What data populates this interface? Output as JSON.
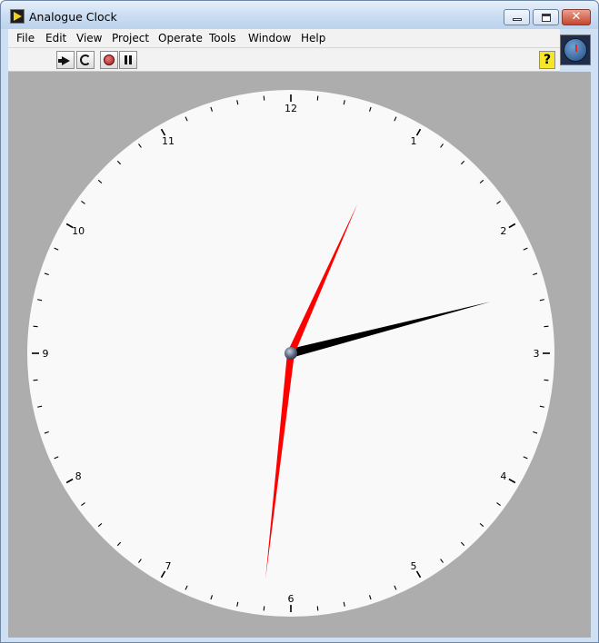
{
  "window": {
    "title": "Analogue Clock",
    "close_symbol": "✕"
  },
  "menu": {
    "items": [
      "File",
      "Edit",
      "View",
      "Project",
      "Operate",
      "Tools",
      "Window",
      "Help"
    ]
  },
  "toolbar": {
    "icons": [
      "run-arrow-icon",
      "run-continuously-icon",
      "abort-icon",
      "pause-icon"
    ],
    "help_label": "?"
  },
  "clock": {
    "numerals": [
      "12",
      "1",
      "2",
      "3",
      "4",
      "5",
      "6",
      "7",
      "8",
      "9",
      "10",
      "11"
    ],
    "time": {
      "hours": 2,
      "minutes": 31,
      "seconds": 4
    },
    "colors": {
      "dial": "#f9f9f9",
      "panel": "#adadad",
      "hour_hand": "#000000",
      "minute_hand": "#ff0000",
      "second_hand": "#ff0000"
    }
  }
}
